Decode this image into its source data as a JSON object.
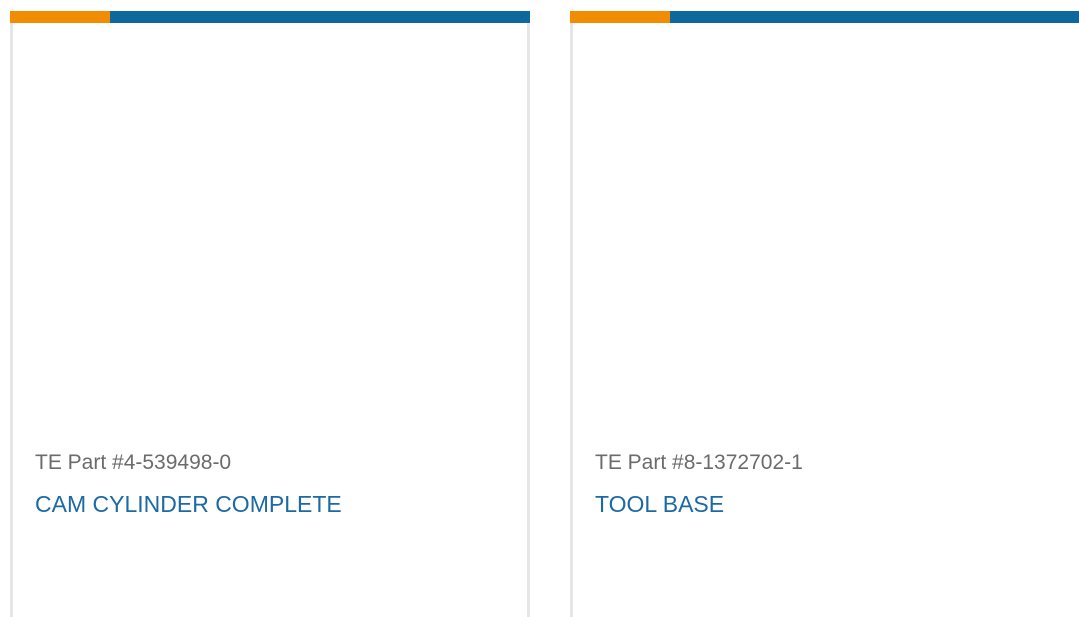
{
  "colors": {
    "accent_orange": "#f28c00",
    "accent_blue": "#0d689e",
    "link": "#1b6aa3",
    "muted_text": "#6b6b6b"
  },
  "products": [
    {
      "part_number": "TE Part #4-539498-0",
      "name": "CAM CYLINDER COMPLETE"
    },
    {
      "part_number": "TE Part #8-1372702-1",
      "name": "TOOL BASE"
    }
  ]
}
